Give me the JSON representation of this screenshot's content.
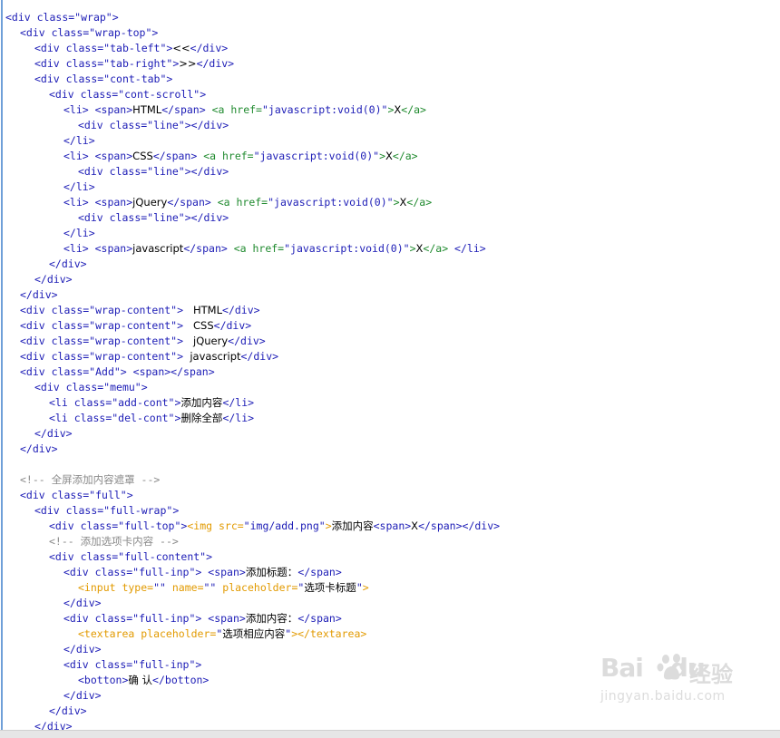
{
  "code_lines": [
    {
      "indent": 0,
      "tokens": [
        [
          "t",
          "<div "
        ],
        [
          "an",
          "class="
        ],
        [
          "av",
          "\"wrap\""
        ],
        [
          "t",
          ">"
        ]
      ]
    },
    {
      "indent": 2,
      "tokens": [
        [
          "t",
          "<div "
        ],
        [
          "an",
          "class="
        ],
        [
          "av",
          "\"wrap-top\""
        ],
        [
          "t",
          ">"
        ]
      ]
    },
    {
      "indent": 4,
      "tokens": [
        [
          "t",
          "<div "
        ],
        [
          "an",
          "class="
        ],
        [
          "av",
          "\"tab-left\""
        ],
        [
          "t",
          ">"
        ],
        [
          "tx",
          "<<"
        ],
        [
          "t",
          "</div>"
        ]
      ]
    },
    {
      "indent": 4,
      "tokens": [
        [
          "t",
          "<div "
        ],
        [
          "an",
          "class="
        ],
        [
          "av",
          "\"tab-right\""
        ],
        [
          "t",
          ">"
        ],
        [
          "tx",
          ">>"
        ],
        [
          "t",
          "</div>"
        ]
      ]
    },
    {
      "indent": 4,
      "tokens": [
        [
          "t",
          "<div "
        ],
        [
          "an",
          "class="
        ],
        [
          "av",
          "\"cont-tab\""
        ],
        [
          "t",
          ">"
        ]
      ]
    },
    {
      "indent": 6,
      "tokens": [
        [
          "t",
          "<div "
        ],
        [
          "an",
          "class="
        ],
        [
          "av",
          "\"cont-scroll\""
        ],
        [
          "t",
          ">"
        ]
      ]
    },
    {
      "indent": 8,
      "tokens": [
        [
          "t",
          "<li> <span>"
        ],
        [
          "tx",
          "HTML"
        ],
        [
          "t",
          "</span> "
        ],
        [
          "ag",
          "<a href="
        ],
        [
          "av",
          "\"javascript:void(0)\""
        ],
        [
          "ag",
          ">"
        ],
        [
          "tx",
          "X"
        ],
        [
          "ag",
          "</a>"
        ]
      ]
    },
    {
      "indent": 10,
      "tokens": [
        [
          "t",
          "<div "
        ],
        [
          "an",
          "class="
        ],
        [
          "av",
          "\"line\""
        ],
        [
          "t",
          "></div>"
        ]
      ]
    },
    {
      "indent": 8,
      "tokens": [
        [
          "t",
          "</li>"
        ]
      ]
    },
    {
      "indent": 8,
      "tokens": [
        [
          "t",
          "<li> <span>"
        ],
        [
          "tx",
          "CSS"
        ],
        [
          "t",
          "</span> "
        ],
        [
          "ag",
          "<a href="
        ],
        [
          "av",
          "\"javascript:void(0)\""
        ],
        [
          "ag",
          ">"
        ],
        [
          "tx",
          "X"
        ],
        [
          "ag",
          "</a>"
        ]
      ]
    },
    {
      "indent": 10,
      "tokens": [
        [
          "t",
          "<div "
        ],
        [
          "an",
          "class="
        ],
        [
          "av",
          "\"line\""
        ],
        [
          "t",
          "></div>"
        ]
      ]
    },
    {
      "indent": 8,
      "tokens": [
        [
          "t",
          "</li>"
        ]
      ]
    },
    {
      "indent": 8,
      "tokens": [
        [
          "t",
          "<li> <span>"
        ],
        [
          "tx",
          "jQuery"
        ],
        [
          "t",
          "</span> "
        ],
        [
          "ag",
          "<a href="
        ],
        [
          "av",
          "\"javascript:void(0)\""
        ],
        [
          "ag",
          ">"
        ],
        [
          "tx",
          "X"
        ],
        [
          "ag",
          "</a>"
        ]
      ]
    },
    {
      "indent": 10,
      "tokens": [
        [
          "t",
          "<div "
        ],
        [
          "an",
          "class="
        ],
        [
          "av",
          "\"line\""
        ],
        [
          "t",
          "></div>"
        ]
      ]
    },
    {
      "indent": 8,
      "tokens": [
        [
          "t",
          "</li>"
        ]
      ]
    },
    {
      "indent": 8,
      "tokens": [
        [
          "t",
          "<li> <span>"
        ],
        [
          "tx",
          "javascript"
        ],
        [
          "t",
          "</span> "
        ],
        [
          "ag",
          "<a href="
        ],
        [
          "av",
          "\"javascript:void(0)\""
        ],
        [
          "ag",
          ">"
        ],
        [
          "tx",
          "X"
        ],
        [
          "ag",
          "</a>"
        ],
        [
          "t",
          " </li>"
        ]
      ]
    },
    {
      "indent": 6,
      "tokens": [
        [
          "t",
          "</div>"
        ]
      ]
    },
    {
      "indent": 4,
      "tokens": [
        [
          "t",
          "</div>"
        ]
      ]
    },
    {
      "indent": 2,
      "tokens": [
        [
          "t",
          "</div>"
        ]
      ]
    },
    {
      "indent": 2,
      "tokens": [
        [
          "t",
          "<div "
        ],
        [
          "an",
          "class="
        ],
        [
          "av",
          "\"wrap-content\""
        ],
        [
          "t",
          ">"
        ],
        [
          "tx",
          "   HTML"
        ],
        [
          "t",
          "</div>"
        ]
      ]
    },
    {
      "indent": 2,
      "tokens": [
        [
          "t",
          "<div "
        ],
        [
          "an",
          "class="
        ],
        [
          "av",
          "\"wrap-content\""
        ],
        [
          "t",
          ">"
        ],
        [
          "tx",
          "   CSS"
        ],
        [
          "t",
          "</div>"
        ]
      ]
    },
    {
      "indent": 2,
      "tokens": [
        [
          "t",
          "<div "
        ],
        [
          "an",
          "class="
        ],
        [
          "av",
          "\"wrap-content\""
        ],
        [
          "t",
          ">"
        ],
        [
          "tx",
          "   jQuery"
        ],
        [
          "t",
          "</div>"
        ]
      ]
    },
    {
      "indent": 2,
      "tokens": [
        [
          "t",
          "<div "
        ],
        [
          "an",
          "class="
        ],
        [
          "av",
          "\"wrap-content\""
        ],
        [
          "t",
          ">"
        ],
        [
          "tx",
          "  javascript"
        ],
        [
          "t",
          "</div>"
        ]
      ]
    },
    {
      "indent": 2,
      "tokens": [
        [
          "t",
          "<div "
        ],
        [
          "an",
          "class="
        ],
        [
          "av",
          "\"Add\""
        ],
        [
          "t",
          "> <span></span>"
        ]
      ]
    },
    {
      "indent": 4,
      "tokens": [
        [
          "t",
          "<div "
        ],
        [
          "an",
          "class="
        ],
        [
          "av",
          "\"memu\""
        ],
        [
          "t",
          ">"
        ]
      ]
    },
    {
      "indent": 6,
      "tokens": [
        [
          "t",
          "<li "
        ],
        [
          "an",
          "class="
        ],
        [
          "av",
          "\"add-cont\""
        ],
        [
          "t",
          ">"
        ],
        [
          "tx",
          "添加内容"
        ],
        [
          "t",
          "</li>"
        ]
      ]
    },
    {
      "indent": 6,
      "tokens": [
        [
          "t",
          "<li "
        ],
        [
          "an",
          "class="
        ],
        [
          "av",
          "\"del-cont\""
        ],
        [
          "t",
          ">"
        ],
        [
          "tx",
          "删除全部"
        ],
        [
          "t",
          "</li>"
        ]
      ]
    },
    {
      "indent": 4,
      "tokens": [
        [
          "t",
          "</div>"
        ]
      ]
    },
    {
      "indent": 2,
      "tokens": [
        [
          "t",
          "</div>"
        ]
      ]
    },
    {
      "indent": 0,
      "tokens": []
    },
    {
      "indent": 2,
      "tokens": [
        [
          "cm",
          "<!-- 全屏添加内容遮罩 -->"
        ]
      ]
    },
    {
      "indent": 2,
      "tokens": [
        [
          "t",
          "<div "
        ],
        [
          "an",
          "class="
        ],
        [
          "av",
          "\"full\""
        ],
        [
          "t",
          ">"
        ]
      ]
    },
    {
      "indent": 4,
      "tokens": [
        [
          "t",
          "<div "
        ],
        [
          "an",
          "class="
        ],
        [
          "av",
          "\"full-wrap\""
        ],
        [
          "t",
          ">"
        ]
      ]
    },
    {
      "indent": 6,
      "tokens": [
        [
          "t",
          "<div "
        ],
        [
          "an",
          "class="
        ],
        [
          "av",
          "\"full-top\""
        ],
        [
          "t",
          ">"
        ],
        [
          "ob",
          "<img src="
        ],
        [
          "av",
          "\"img/add.png\""
        ],
        [
          "ob",
          ">"
        ],
        [
          "tx",
          "添加内容"
        ],
        [
          "t",
          "<span>"
        ],
        [
          "tx",
          "X"
        ],
        [
          "t",
          "</span></div>"
        ]
      ]
    },
    {
      "indent": 6,
      "tokens": [
        [
          "cm",
          "<!-- 添加选项卡内容 -->"
        ]
      ]
    },
    {
      "indent": 6,
      "tokens": [
        [
          "t",
          "<div "
        ],
        [
          "an",
          "class="
        ],
        [
          "av",
          "\"full-content\""
        ],
        [
          "t",
          ">"
        ]
      ]
    },
    {
      "indent": 8,
      "tokens": [
        [
          "t",
          "<div "
        ],
        [
          "an",
          "class="
        ],
        [
          "av",
          "\"full-inp\""
        ],
        [
          "t",
          "> <span>"
        ],
        [
          "tx",
          "添加标题："
        ],
        [
          "t",
          "</span>"
        ]
      ]
    },
    {
      "indent": 10,
      "tokens": [
        [
          "ob",
          "<input type="
        ],
        [
          "av",
          "\"\""
        ],
        [
          "ob",
          " name="
        ],
        [
          "av",
          "\"\""
        ],
        [
          "ob",
          " placeholder="
        ],
        [
          "av",
          "\""
        ],
        [
          "tx",
          "选项卡标题"
        ],
        [
          "av",
          "\""
        ],
        [
          "ob",
          ">"
        ]
      ]
    },
    {
      "indent": 8,
      "tokens": [
        [
          "t",
          "</div>"
        ]
      ]
    },
    {
      "indent": 8,
      "tokens": [
        [
          "t",
          "<div "
        ],
        [
          "an",
          "class="
        ],
        [
          "av",
          "\"full-inp\""
        ],
        [
          "t",
          "> <span>"
        ],
        [
          "tx",
          "添加内容："
        ],
        [
          "t",
          "</span>"
        ]
      ]
    },
    {
      "indent": 10,
      "tokens": [
        [
          "ob",
          "<textarea placeholder="
        ],
        [
          "av",
          "\""
        ],
        [
          "tx",
          "选项相应内容"
        ],
        [
          "av",
          "\""
        ],
        [
          "ob",
          "></textarea>"
        ]
      ]
    },
    {
      "indent": 8,
      "tokens": [
        [
          "t",
          "</div>"
        ]
      ]
    },
    {
      "indent": 8,
      "tokens": [
        [
          "t",
          "<div "
        ],
        [
          "an",
          "class="
        ],
        [
          "av",
          "\"full-inp\""
        ],
        [
          "t",
          ">"
        ]
      ]
    },
    {
      "indent": 10,
      "tokens": [
        [
          "t",
          "<botton>"
        ],
        [
          "tx",
          "确 认"
        ],
        [
          "t",
          "</botton>"
        ]
      ]
    },
    {
      "indent": 8,
      "tokens": [
        [
          "t",
          "</div>"
        ]
      ]
    },
    {
      "indent": 6,
      "tokens": [
        [
          "t",
          "</div>"
        ]
      ]
    },
    {
      "indent": 4,
      "tokens": [
        [
          "t",
          "</div>"
        ]
      ]
    }
  ],
  "watermark": {
    "logo_text": "Bai",
    "logo_text2": "du",
    "brand": "经验",
    "url": "jingyan.baidu.com"
  },
  "colors": {
    "tag": "#1c1cb6",
    "comment": "#8a8a8a",
    "orange_tag": "#e29a00",
    "anchor_tag": "#1f8a2e",
    "gutter": "#6f9fd8"
  }
}
